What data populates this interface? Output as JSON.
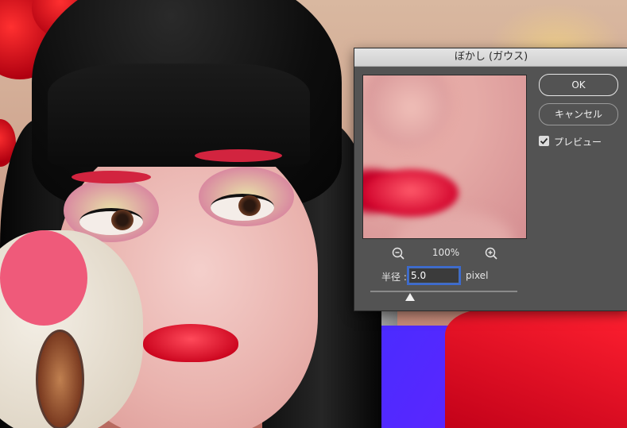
{
  "dialog": {
    "title": "ぼかし (ガウス)",
    "ok_label": "OK",
    "cancel_label": "キャンセル",
    "preview_label": "プレビュー",
    "preview_checked": true,
    "zoom_level": "100%",
    "zoom_out_icon": "zoom-out-icon",
    "zoom_in_icon": "zoom-in-icon",
    "radius_label": "半径 :",
    "radius_value": "5.0",
    "radius_unit": "pixel",
    "radius_slider_fraction": 0.27
  },
  "colors": {
    "dialog_bg": "#535353",
    "selection": "#3d6fd8",
    "accent_red": "#d2243f"
  }
}
